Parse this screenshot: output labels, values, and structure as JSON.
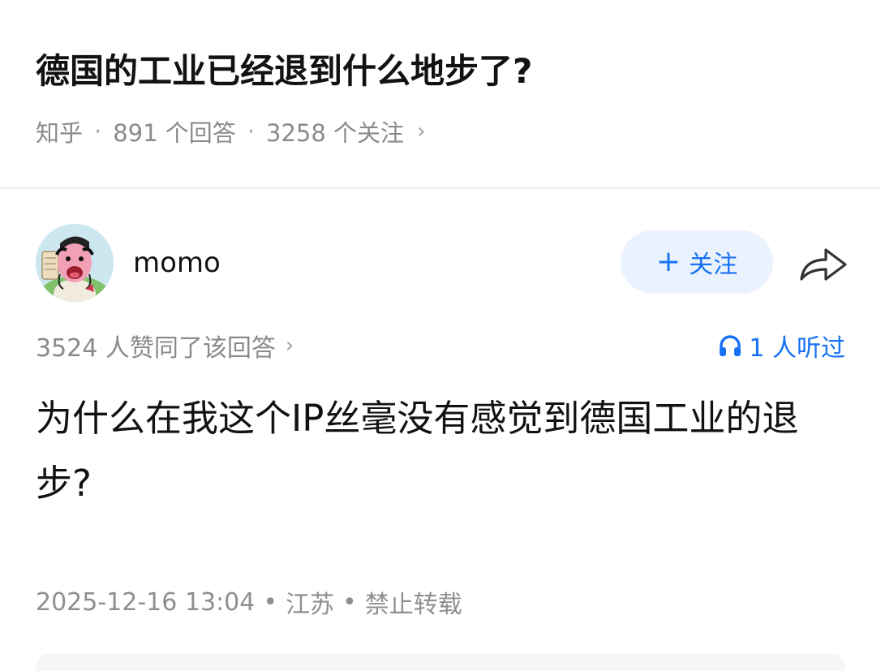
{
  "question": {
    "title": "德国的工业已经退到什么地步了?",
    "source": "知乎",
    "separator": "·",
    "answers_count": "891 个回答",
    "followers_count": "3258 个关注",
    "chevron": "›"
  },
  "answer": {
    "author": {
      "name": "momo",
      "avatar_icon": "cartoon-avatar"
    },
    "follow_button": {
      "plus": "+",
      "label": "关注"
    },
    "share_icon": "share-arrow-icon",
    "upvotes_text": "3524 人赞同了该回答",
    "upvotes_chevron": "›",
    "listened": {
      "icon": "headphones-icon",
      "text": "1 人听过"
    },
    "content": "为什么在我这个IP丝毫没有感觉到德国工业的退步?",
    "footer": {
      "datetime": "2025-12-16 13:04",
      "separator": "•",
      "location": "江苏",
      "copyright": "禁止转载"
    }
  },
  "colors": {
    "accent": "#1772f6",
    "follow_bg": "#eaf2fd",
    "meta_text": "#8a8a8a",
    "divider": "#eeeeee"
  }
}
